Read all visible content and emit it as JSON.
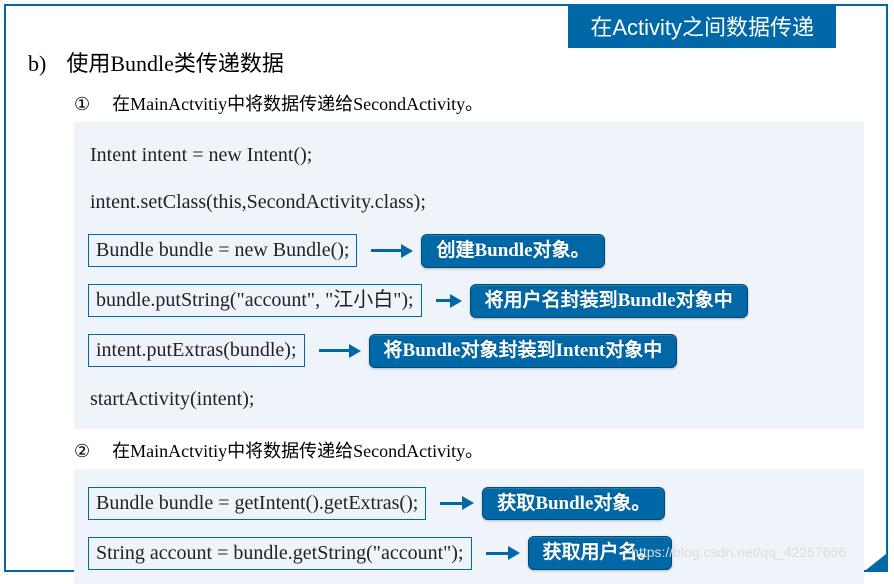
{
  "banner": "在Activity之间数据传递",
  "heading": {
    "label": "b)",
    "text": "使用Bundle类传递数据"
  },
  "step1": {
    "num": "①",
    "text": "在MainActvitiy中将数据传递给SecondActivity。"
  },
  "code1": {
    "l1": "Intent intent = new Intent();",
    "l2": "intent.setClass(this,SecondActivity.class);",
    "l3": "Bundle bundle = new Bundle();",
    "b3a": "创建",
    "b3b": "Bundle",
    "b3c": "对象。",
    "l4": "bundle.putString(\"account\", \"江小白\");",
    "b4a": "将用户名封装到",
    "b4b": "Bundle",
    "b4c": "对象中",
    "l5": "intent.putExtras(bundle);",
    "b5a": "将",
    "b5b": "Bundle",
    "b5c": "对象封装到",
    "b5d": "Intent",
    "b5e": "对象中",
    "l6": "startActivity(intent);"
  },
  "step2": {
    "num": "②",
    "text": "在MainActvitiy中将数据传递给SecondActivity。"
  },
  "code2": {
    "l1": "Bundle bundle = getIntent().getExtras();",
    "b1a": "获取",
    "b1b": "Bundle",
    "b1c": "对象。",
    "l2": "String account = bundle.getString(\"account\");",
    "b2": "获取用户名。"
  },
  "watermark": "https://blog.csdn.net/qq_42257666"
}
